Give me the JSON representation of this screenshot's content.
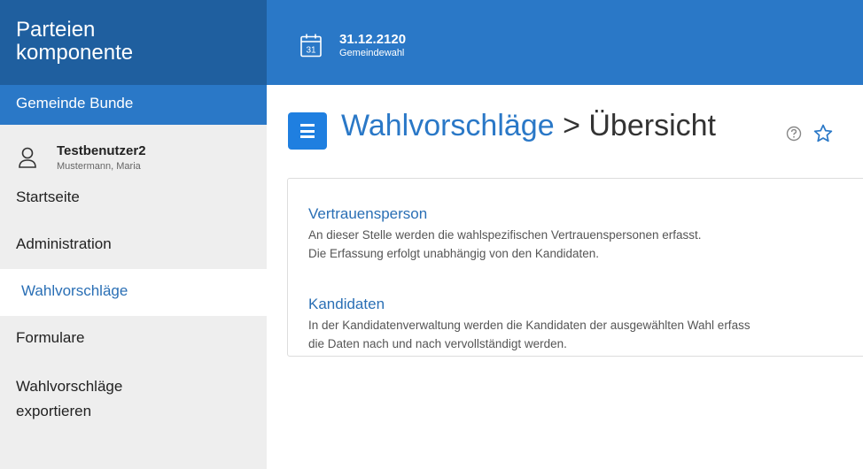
{
  "brand": {
    "line1": "Parteien",
    "line2": "komponente"
  },
  "municipality": "Gemeinde Bunde",
  "user": {
    "username": "Testbenutzer2",
    "full_name": "Mustermann, Maria"
  },
  "nav": [
    {
      "label": "Startseite"
    },
    {
      "label": "Administration"
    },
    {
      "label": "Wahlvorschläge"
    },
    {
      "label": "Formulare"
    },
    {
      "label": "Wahlvorschläge\nexportieren"
    }
  ],
  "topbar": {
    "calendar_day": "31",
    "date": "31.12.2120",
    "election": "Gemeindewahl"
  },
  "heading": {
    "part1": "Wahlvorschläge",
    "part2": " > Übersicht"
  },
  "sections": [
    {
      "link": "Vertrauensperson",
      "lines": [
        "An dieser Stelle werden die wahlspezifischen Vertrauenspersonen erfasst.",
        "Die Erfassung erfolgt unabhängig von den Kandidaten."
      ]
    },
    {
      "link": "Kandidaten",
      "lines": [
        "In der Kandidatenverwaltung werden die Kandidaten der ausgewählten Wahl erfass",
        "die Daten nach und nach vervollständigt werden."
      ]
    }
  ],
  "colors": {
    "brand_dark": "#1f5f9f",
    "brand": "#2a78c7",
    "button": "#1f7fe0",
    "link": "#2a6fb5"
  },
  "icons": [
    "user-icon",
    "calendar-icon",
    "menu-icon",
    "help-icon",
    "star-icon"
  ]
}
